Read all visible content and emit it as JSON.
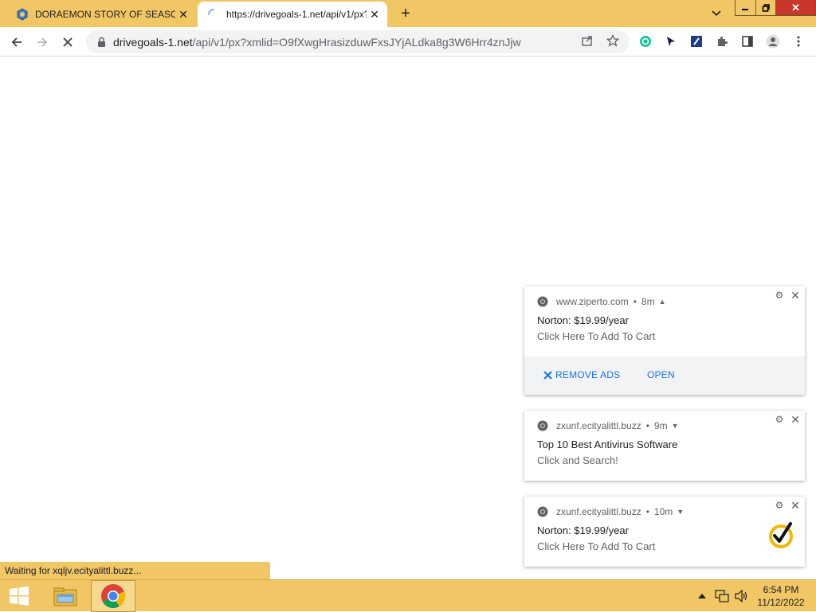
{
  "browser": {
    "tabs": [
      {
        "title": "DORAEMON STORY OF SEASONS",
        "state": "inactive",
        "favicon": "game-shield-icon"
      },
      {
        "title": "https://drivegoals-1.net/api/v1/px?xmlid=O9fXwgHrasizduwFxsJYjALdka8g3W6Hrr4znJjw",
        "state": "active-loading",
        "favicon": "loading-spinner-icon"
      }
    ],
    "address": {
      "domain": "drivegoals-1.net",
      "path": "/api/v1/px?xmlid=O9fXwgHrasizduwFxsJYjALdka8g3W6Hrr4znJjw"
    },
    "status_text": "Waiting for xqljv.ecityalittl.buzz..."
  },
  "notifications": [
    {
      "source": "www.ziperto.com",
      "age": "8m",
      "expanded": true,
      "title": "Norton: $19.99/year",
      "message": "Click Here To Add To Cart",
      "actions": {
        "remove_ads": "REMOVE ADS",
        "open": "OPEN"
      }
    },
    {
      "source": "zxunf.ecityalittl.buzz",
      "age": "9m",
      "expanded": false,
      "title": "Top 10 Best Antivirus Software",
      "message": "Click and Search!"
    },
    {
      "source": "zxunf.ecityalittl.buzz",
      "age": "10m",
      "expanded": false,
      "title": "Norton: $19.99/year",
      "message": "Click Here To Add To Cart",
      "image": "norton-checkmark-icon"
    }
  ],
  "taskbar": {
    "time": "6:54 PM",
    "date": "11/12/2022"
  },
  "colors": {
    "accent": "#f1c665",
    "link_blue": "#1a73e8",
    "close_red": "#c9372c"
  }
}
